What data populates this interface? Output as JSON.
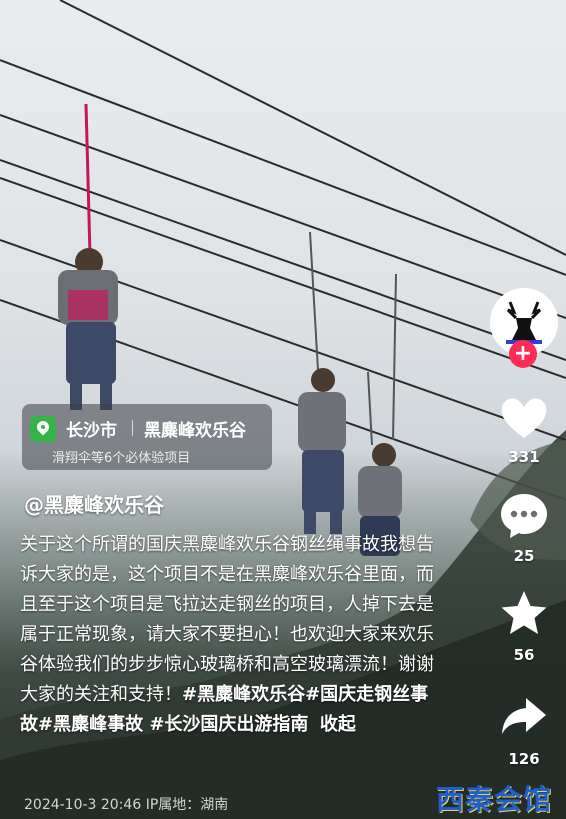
{
  "location": {
    "city": "长沙市",
    "place": "黑麋峰欢乐谷",
    "subtitle": "滑翔伞等6个必体验项目"
  },
  "author": "@黑麋峰欢乐谷",
  "caption": {
    "text": "关于这个所谓的国庆黑麋峰欢乐谷钢丝绳事故我想告诉大家的是，这个项目不是在黑麋峰欢乐谷里面，而且至于这个项目是飞拉达走钢丝的项目，人掉下去是属于正常现象，请大家不要担心！也欢迎大家来欢乐谷体验我们的步步惊心玻璃桥和高空玻璃漂流！谢谢大家的关注和支持！",
    "tags": "#黑麋峰欢乐谷#国庆走钢丝事故#黑麋峰事故 #长沙国庆出游指南",
    "fold": "收起"
  },
  "post_info": "2024-10-3 20:46  IP属地：湖南",
  "actions": {
    "likes": "331",
    "comments": "25",
    "favorites": "56",
    "shares": "126"
  },
  "icons": [
    "location-pin-icon",
    "plus-icon",
    "heart-icon",
    "comment-icon",
    "star-icon",
    "share-icon"
  ],
  "watermark": "西秦会馆"
}
